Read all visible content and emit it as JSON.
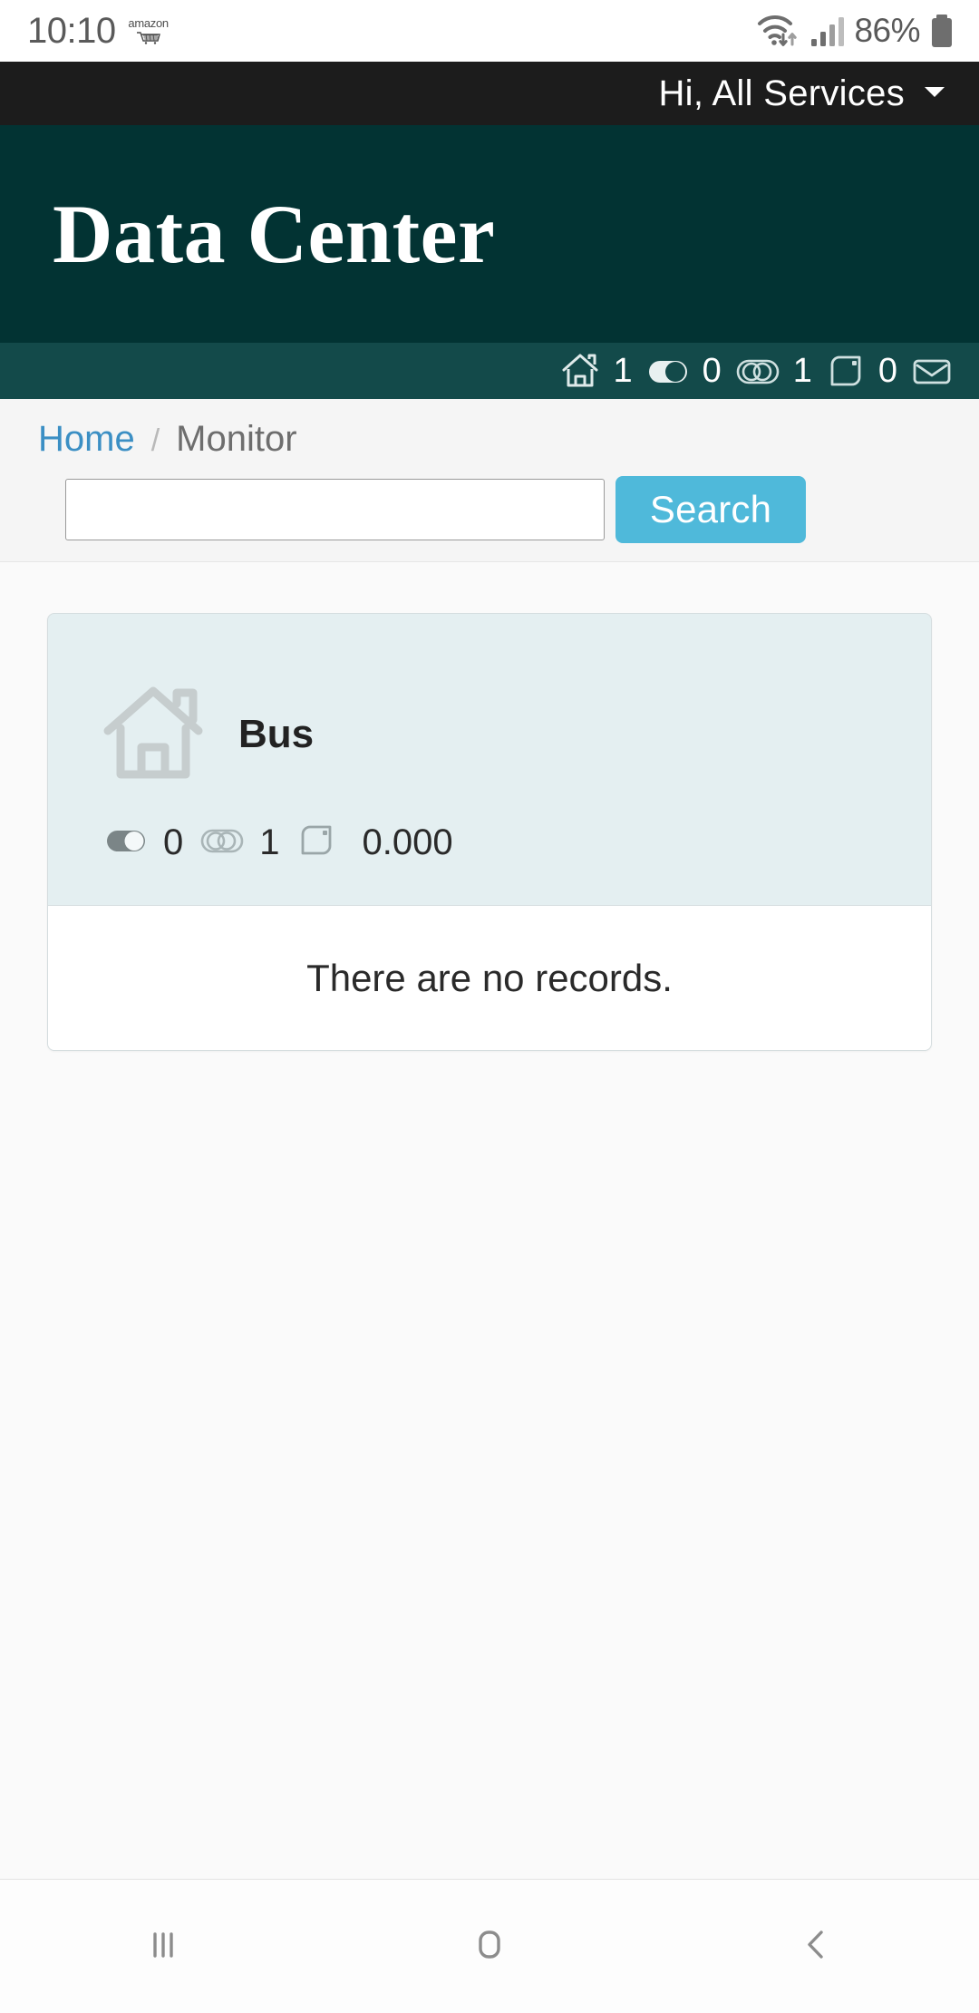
{
  "status_bar": {
    "time": "10:10",
    "notification_app": "amazon",
    "notification_icon": "amazon-cart-icon",
    "wifi_icon": "wifi-transfer-icon",
    "signal_icon": "cellular-signal-icon",
    "battery_percent": "86%",
    "battery_icon": "battery-icon"
  },
  "greeting_bar": {
    "text": "Hi,  All Services",
    "caret_icon": "chevron-down-icon"
  },
  "header": {
    "title": "Data Center",
    "bg_color": "#023333"
  },
  "stats_bar": {
    "bg_color": "#134a4a",
    "items": [
      {
        "icon": "house-icon",
        "value": "1"
      },
      {
        "icon": "toggle-on-icon",
        "value": "0"
      },
      {
        "icon": "toggle-circles-icon",
        "value": "1"
      },
      {
        "icon": "note-icon",
        "value": "0"
      },
      {
        "icon": "envelope-icon",
        "value": ""
      }
    ]
  },
  "breadcrumb": {
    "home": "Home",
    "separator": "/",
    "current": "Monitor"
  },
  "search": {
    "value": "",
    "placeholder": "",
    "button_label": "Search",
    "button_color": "#4fb9da"
  },
  "card": {
    "icon": "house-outline-icon",
    "title": "Bus",
    "bg_color": "#e4eff1",
    "stats": [
      {
        "icon": "toggle-on-icon",
        "value": "0"
      },
      {
        "icon": "toggle-circles-icon",
        "value": "1"
      },
      {
        "icon": "note-icon",
        "value": "0.000"
      }
    ],
    "empty_message": "There are no records."
  },
  "nav_bar": {
    "recents_icon": "recents-icon",
    "home_icon": "home-square-icon",
    "back_icon": "back-chevron-icon"
  }
}
